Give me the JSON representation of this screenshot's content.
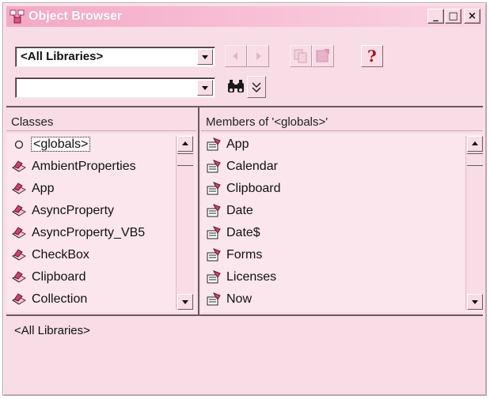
{
  "window": {
    "title": "Object Browser",
    "controls": {
      "minimize": "_",
      "maximize": "□",
      "close": "×"
    }
  },
  "toolbar": {
    "library_value": "<All Libraries>",
    "search_value": "",
    "help_glyph": "?"
  },
  "classes": {
    "header": "Classes",
    "items": [
      {
        "label": "<globals>",
        "icon": "globals-circle-icon",
        "selected": true
      },
      {
        "label": "AmbientProperties",
        "icon": "class-icon"
      },
      {
        "label": "App",
        "icon": "class-icon"
      },
      {
        "label": "AsyncProperty",
        "icon": "class-icon"
      },
      {
        "label": "AsyncProperty_VB5",
        "icon": "class-icon"
      },
      {
        "label": "CheckBox",
        "icon": "class-icon"
      },
      {
        "label": "Clipboard",
        "icon": "class-icon"
      },
      {
        "label": "Collection",
        "icon": "class-icon"
      }
    ]
  },
  "members": {
    "header": "Members of '<globals>'",
    "items": [
      {
        "label": "App",
        "icon": "property-icon"
      },
      {
        "label": "Calendar",
        "icon": "property-icon"
      },
      {
        "label": "Clipboard",
        "icon": "property-icon"
      },
      {
        "label": "Date",
        "icon": "property-icon"
      },
      {
        "label": "Date$",
        "icon": "property-icon"
      },
      {
        "label": "Forms",
        "icon": "property-icon"
      },
      {
        "label": "Licenses",
        "icon": "property-icon"
      },
      {
        "label": "Now",
        "icon": "property-icon"
      }
    ]
  },
  "description": {
    "text": "<All Libraries>"
  }
}
